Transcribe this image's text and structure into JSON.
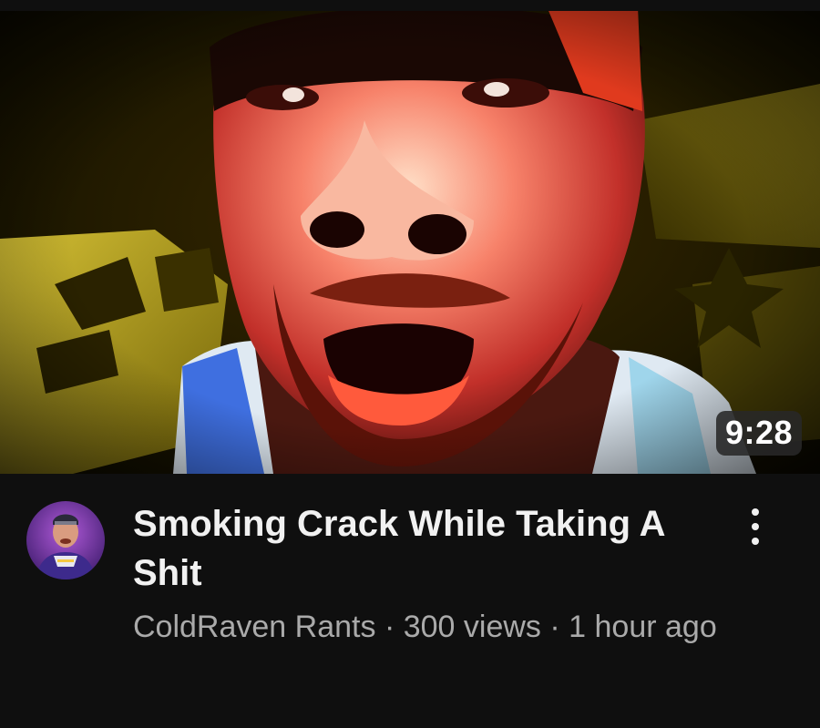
{
  "video": {
    "duration": "9:28",
    "title": "Smoking Crack While Taking A Shit",
    "channel": "ColdRaven Rants",
    "separator": "·",
    "views": "300 views",
    "age": "1 hour ago"
  },
  "icons": {
    "more": "vertical-ellipsis-icon"
  },
  "colors": {
    "background": "#0f0f0f",
    "title": "#f1f1f1",
    "secondary_text": "#aaaaaa",
    "badge": "#282828"
  }
}
